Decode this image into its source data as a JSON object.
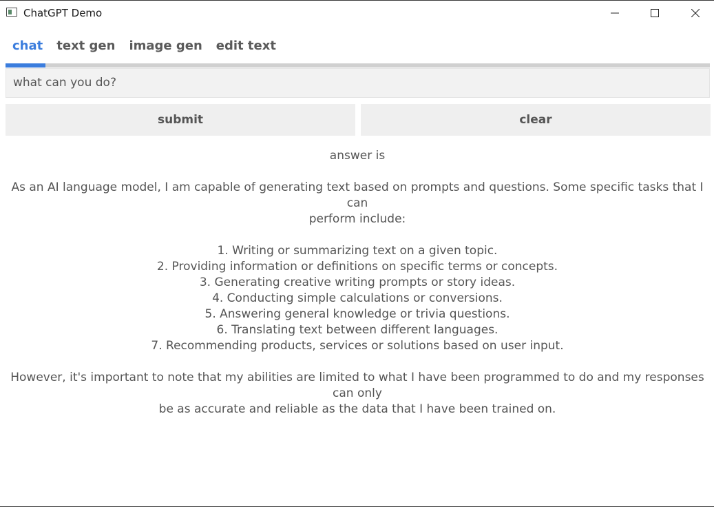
{
  "window": {
    "title": "ChatGPT Demo"
  },
  "tabs": [
    {
      "label": "chat",
      "active": true
    },
    {
      "label": "text gen",
      "active": false
    },
    {
      "label": "image gen",
      "active": false
    },
    {
      "label": "edit text",
      "active": false
    }
  ],
  "prompt": {
    "value": "what can you do?"
  },
  "buttons": {
    "submit": "submit",
    "clear": "clear"
  },
  "answer": {
    "heading": "answer is",
    "intro_line1": "As an AI language model, I am capable of generating text based on prompts and questions. Some specific tasks that I can",
    "intro_line2": "perform include:",
    "items": [
      "1. Writing or summarizing text on a given topic.",
      "2. Providing information or definitions on specific terms or concepts.",
      "3. Generating creative writing prompts or story ideas.",
      "4. Conducting simple calculations or conversions.",
      "5. Answering general knowledge or trivia questions.",
      "6. Translating text between different languages.",
      "7. Recommending products, services or solutions based on user input."
    ],
    "closing_line1": "However, it's important to note that my abilities are limited to what I have been programmed to do and my responses can only",
    "closing_line2": "be as accurate and reliable as the data that I have been trained on."
  },
  "colors": {
    "accent": "#3b7ddd",
    "text": "#555555",
    "input_bg": "#f2f2f2",
    "button_bg": "#efefef"
  },
  "icons": {
    "app": "app-window-icon",
    "minimize": "minimize-icon",
    "maximize": "maximize-icon",
    "close": "close-icon"
  }
}
